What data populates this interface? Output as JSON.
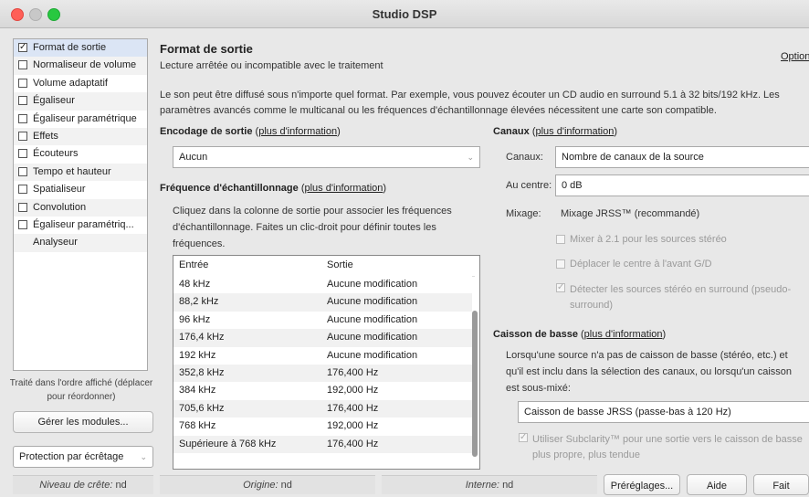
{
  "window": {
    "title": "Studio DSP"
  },
  "sidebar": {
    "items": [
      {
        "label": "Format de sortie",
        "checked": true,
        "selected": true,
        "has_checkbox": true
      },
      {
        "label": "Normaliseur de volume",
        "checked": false,
        "has_checkbox": true
      },
      {
        "label": "Volume adaptatif",
        "checked": false,
        "has_checkbox": true
      },
      {
        "label": "Égaliseur",
        "checked": false,
        "has_checkbox": true
      },
      {
        "label": "Égaliseur paramétrique",
        "checked": false,
        "has_checkbox": true
      },
      {
        "label": "Effets",
        "checked": false,
        "has_checkbox": true
      },
      {
        "label": "Écouteurs",
        "checked": false,
        "has_checkbox": true
      },
      {
        "label": "Tempo et hauteur",
        "checked": false,
        "has_checkbox": true
      },
      {
        "label": "Spatialiseur",
        "checked": false,
        "has_checkbox": true
      },
      {
        "label": "Convolution",
        "checked": false,
        "has_checkbox": true
      },
      {
        "label": "Égaliseur paramétriq...",
        "checked": false,
        "has_checkbox": true
      },
      {
        "label": "Analyseur",
        "checked": false,
        "has_checkbox": false
      }
    ],
    "note": "Traité dans l'ordre affiché (déplacer pour réordonner)",
    "manage_button": "Gérer les modules...",
    "protection_select": "Protection par écrêtage"
  },
  "header": {
    "title": "Format de sortie",
    "subtitle": "Lecture arrêtée ou incompatible avec le traitement",
    "options_link": "Option"
  },
  "description": "Le son peut être diffusé sous n'importe quel format. Par exemple, vous pouvez écouter un CD audio en surround 5.1 à 32 bits/192 kHz.  Les paramètres avancés comme le multicanal ou les fréquences d'échantillonnage élevées nécessitent une carte son compatible.",
  "more_info": "plus d'information",
  "encoding": {
    "title": "Encodage de sortie",
    "value": "Aucun"
  },
  "sample_rate": {
    "title": "Fréquence d'échantillonnage",
    "instructions": "Cliquez dans la colonne de sortie pour associer les fréquences d'échantillonnage. Faites un clic-droit pour définir toutes les fréquences.",
    "columns": [
      "Entrée",
      "Sortie"
    ],
    "rows": [
      [
        "48 kHz",
        "Aucune modification"
      ],
      [
        "88,2 kHz",
        "Aucune modification"
      ],
      [
        "96 kHz",
        "Aucune modification"
      ],
      [
        "176,4 kHz",
        "Aucune modification"
      ],
      [
        "192 kHz",
        "Aucune modification"
      ],
      [
        "352,8 kHz",
        "176,400 Hz"
      ],
      [
        "384 kHz",
        "192,000 Hz"
      ],
      [
        "705,6 kHz",
        "176,400 Hz"
      ],
      [
        "768 kHz",
        "192,000 Hz"
      ],
      [
        "Supérieure à 768 kHz",
        "176,400 Hz"
      ]
    ]
  },
  "channels": {
    "title": "Canaux",
    "channels_label": "Canaux:",
    "channels_value": "Nombre de canaux de la source",
    "center_label": "Au centre:",
    "center_value": "0 dB",
    "mix_label": "Mixage:",
    "mix_value": "Mixage JRSS™ (recommandé)",
    "opt1": "Mixer à 2.1 pour les sources stéréo",
    "opt2": "Déplacer le centre à l'avant G/D",
    "opt3": "Détecter les sources stéréo en surround (pseudo-surround)"
  },
  "subwoofer": {
    "title": "Caisson de basse",
    "text": "Lorsqu'une source n'a pas de caisson de basse (stéréo, etc.) et qu'il est inclu dans la sélection des canaux, ou lorsqu'un caisson est sous-mixé:",
    "value": "Caisson de basse JRSS (passe-bas à 120 Hz)",
    "opt": "Utiliser Subclarity™ pour une sortie vers le caisson de basse plus propre, plus tendue"
  },
  "status": {
    "peak_label": "Niveau de crête:",
    "peak_value": "nd",
    "origin_label": "Origine:",
    "origin_value": "nd",
    "internal_label": "Interne:",
    "internal_value": "nd"
  },
  "buttons": {
    "presets": "Préréglages...",
    "help": "Aide",
    "done": "Fait"
  }
}
